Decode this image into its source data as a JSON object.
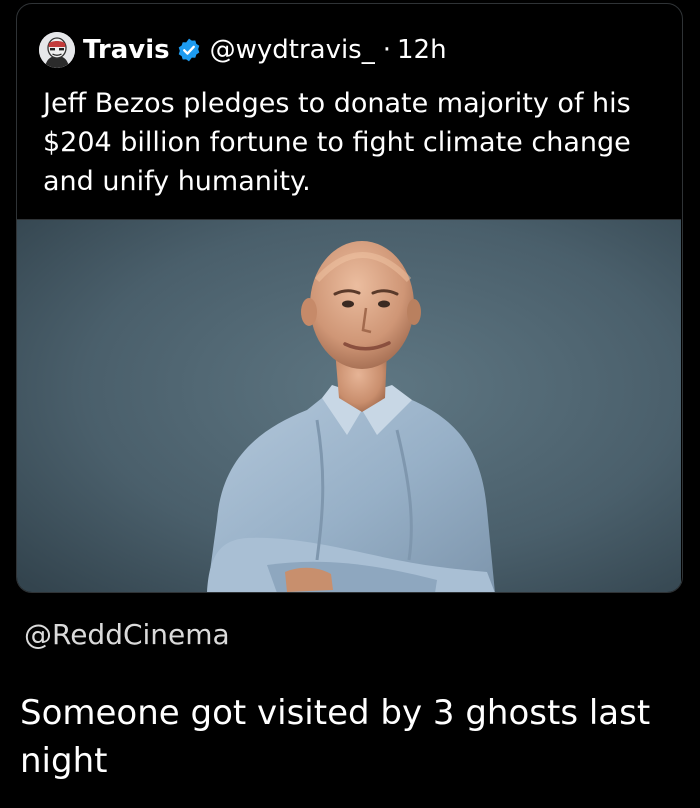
{
  "tweet": {
    "author_name": "Travis",
    "handle": "@wydtravis_",
    "separator": "·",
    "time": "12h",
    "text": "Jeff Bezos pledges to donate majority of his $204 billion fortune to fight climate change and unify humanity.",
    "verified_color": "#1d9bf0",
    "avatar_icon": "masked-face-avatar-icon",
    "media_description_icon": "portrait-photo"
  },
  "source": {
    "handle": "@ReddCinema"
  },
  "caption": {
    "text": "Someone got visited by 3 ghosts last night"
  },
  "colors": {
    "background": "#000000",
    "text": "#ffffff",
    "border": "#2f3336",
    "photo_backdrop": "#4f6470",
    "shirt": "#9fb6cc"
  }
}
